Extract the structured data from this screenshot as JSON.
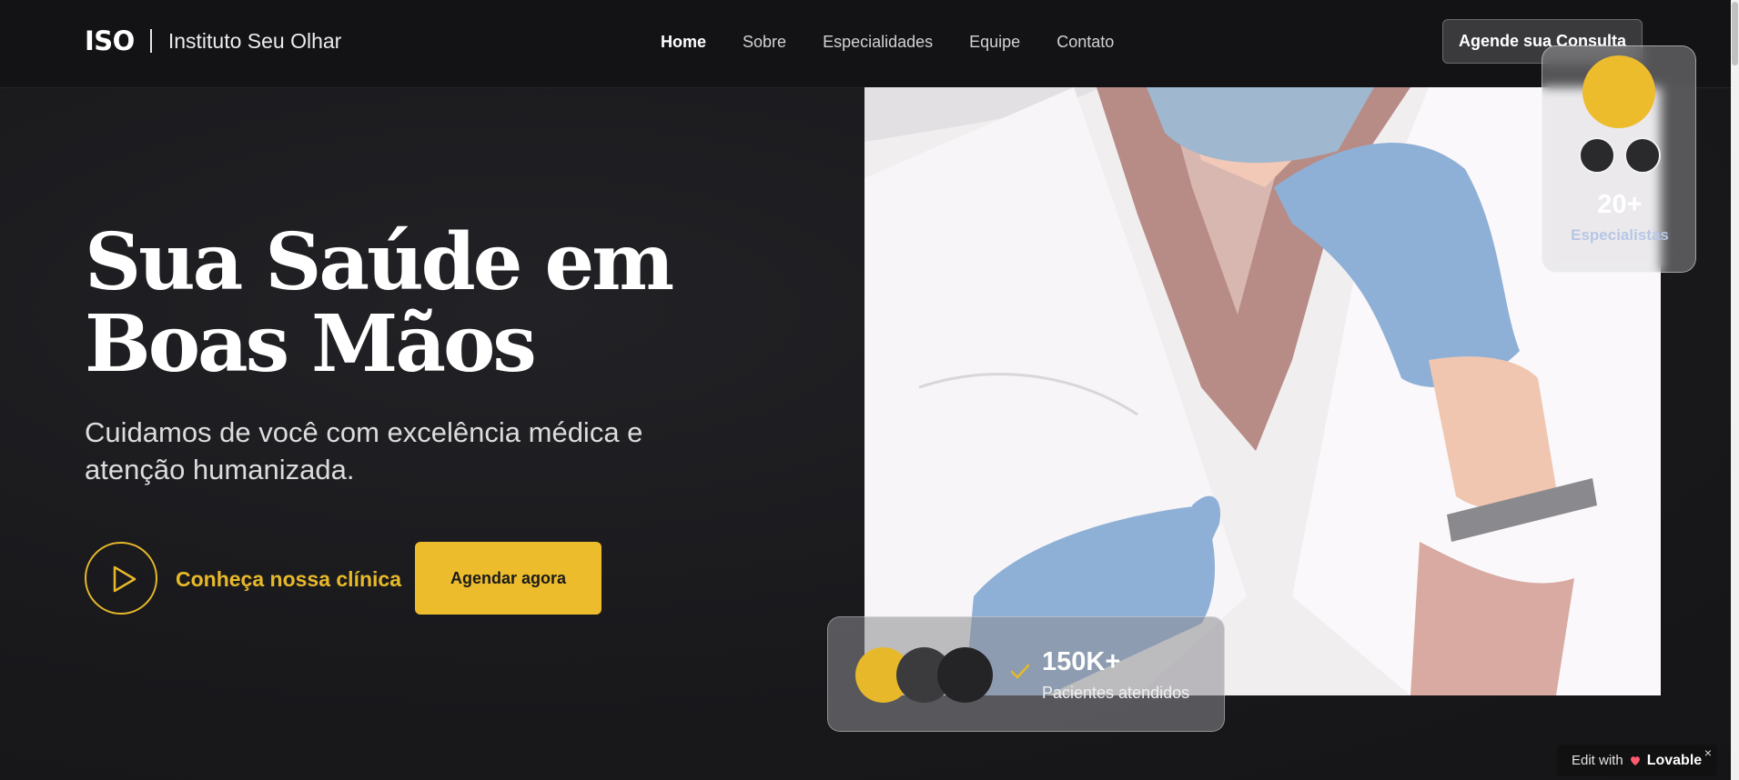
{
  "header": {
    "logo_mark": "ISO",
    "logo_name": "Instituto Seu Olhar",
    "nav": [
      "Home",
      "Sobre",
      "Especialidades",
      "Equipe",
      "Contato"
    ],
    "cta": "Agende sua Consulta"
  },
  "hero": {
    "title": "Sua Saúde em Boas Mãos",
    "subtitle": "Cuidamos de você com excelência médica e atenção humanizada.",
    "play_label": "Conheça nossa clínica",
    "book_button": "Agendar agora"
  },
  "stats": {
    "specialists_value": "20+",
    "specialists_label": "Especialistas",
    "patients_value": "150K+",
    "patients_label": "Pacientes atendidos"
  },
  "badge": {
    "edit_with": "Edit with",
    "brand": "Lovable",
    "close": "×"
  },
  "colors": {
    "accent": "#edbc2c",
    "background": "#19191c"
  },
  "icons": [
    "play-icon",
    "check-icon",
    "close-icon",
    "lovable-heart-icon"
  ]
}
